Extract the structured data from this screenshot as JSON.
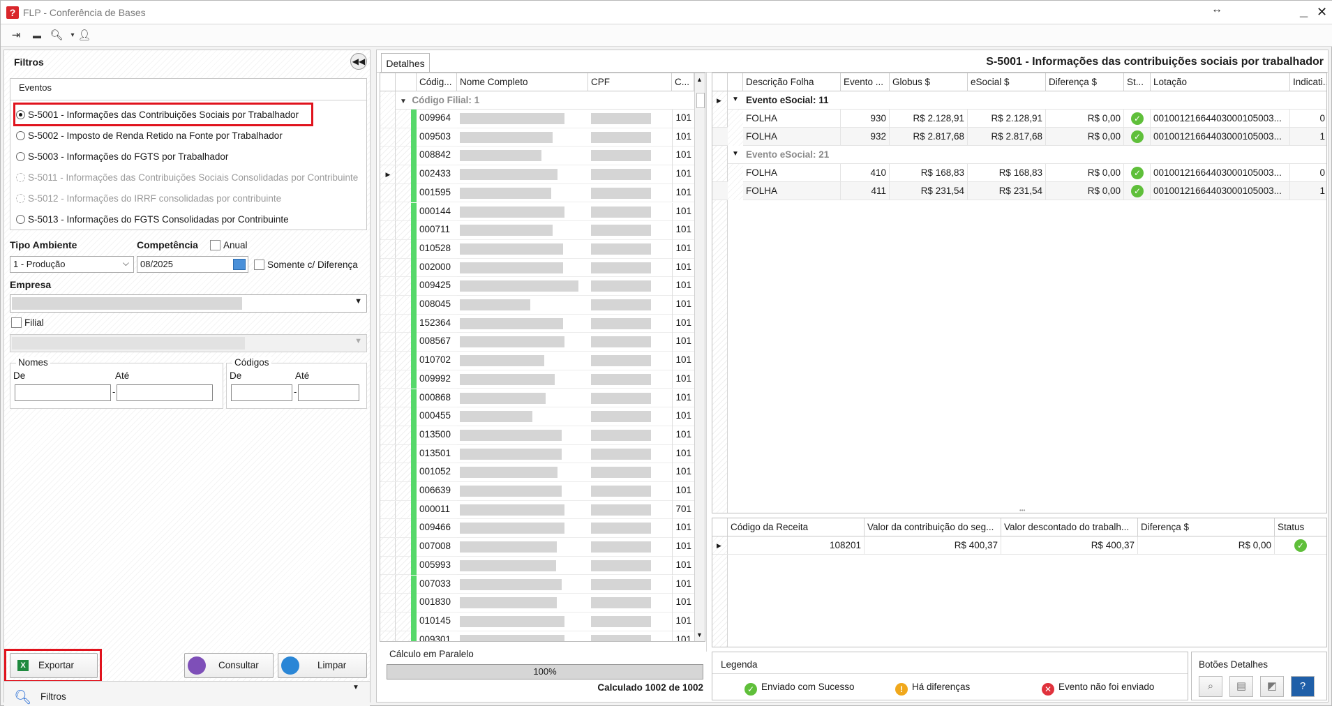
{
  "window": {
    "title": "FLP - Conferência de Bases",
    "logo_letter": "?"
  },
  "filters": {
    "title": "Filtros",
    "eventos_label": "Eventos",
    "events": [
      {
        "label": "S-5001 - Informações das Contribuições Sociais por Trabalhador",
        "selected": true,
        "enabled": true
      },
      {
        "label": "S-5002 - Imposto de Renda Retido na Fonte por Trabalhador",
        "selected": false,
        "enabled": true
      },
      {
        "label": "S-5003 - Informações do FGTS por Trabalhador",
        "selected": false,
        "enabled": true
      },
      {
        "label": "S-5011 - Informações das Contribuições Sociais Consolidadas por Contribuinte",
        "selected": false,
        "enabled": false
      },
      {
        "label": "S-5012 - Informações do IRRF consolidadas por contribuinte",
        "selected": false,
        "enabled": false
      },
      {
        "label": "S-5013 - Informações do FGTS Consolidadas por Contribuinte",
        "selected": false,
        "enabled": true
      }
    ],
    "tipo_ambiente_label": "Tipo Ambiente",
    "tipo_ambiente_value": "1 - Produção",
    "competencia_label": "Competência",
    "competencia_value": "08/2025",
    "anual_label": "Anual",
    "somente_diff_label": "Somente c/ Diferença",
    "empresa_label": "Empresa",
    "filial_label": "Filial",
    "nomes_label": "Nomes",
    "codigos_label": "Códigos",
    "de_label": "De",
    "ate_label": "Até",
    "export_label": "Exportar",
    "consultar_label": "Consultar",
    "limpar_label": "Limpar",
    "tab_label": "Filtros"
  },
  "details": {
    "tab_label": "Detalhes",
    "event_title": "S-5001 - Informações das contribuições sociais por trabalhador",
    "left_grid": {
      "headers": [
        "Códig...",
        "Nome Completo",
        "CPF",
        "C..."
      ],
      "group_label": "Código Filial: 1",
      "rows": [
        {
          "code": "009964",
          "c": "101"
        },
        {
          "code": "009503",
          "c": "101"
        },
        {
          "code": "008842",
          "c": "101"
        },
        {
          "code": "002433",
          "c": "101"
        },
        {
          "code": "001595",
          "c": "101"
        },
        {
          "code": "000144",
          "c": "101"
        },
        {
          "code": "000711",
          "c": "101"
        },
        {
          "code": "010528",
          "c": "101"
        },
        {
          "code": "002000",
          "c": "101"
        },
        {
          "code": "009425",
          "c": "101"
        },
        {
          "code": "008045",
          "c": "101"
        },
        {
          "code": "152364",
          "c": "101"
        },
        {
          "code": "008567",
          "c": "101"
        },
        {
          "code": "010702",
          "c": "101"
        },
        {
          "code": "009992",
          "c": "101"
        },
        {
          "code": "000868",
          "c": "101"
        },
        {
          "code": "000455",
          "c": "101"
        },
        {
          "code": "013500",
          "c": "101"
        },
        {
          "code": "013501",
          "c": "101"
        },
        {
          "code": "001052",
          "c": "101"
        },
        {
          "code": "006639",
          "c": "101"
        },
        {
          "code": "000011",
          "c": "701"
        },
        {
          "code": "009466",
          "c": "101"
        },
        {
          "code": "007008",
          "c": "101"
        },
        {
          "code": "005993",
          "c": "101"
        },
        {
          "code": "007033",
          "c": "101"
        },
        {
          "code": "001830",
          "c": "101"
        },
        {
          "code": "010145",
          "c": "101"
        },
        {
          "code": "009301",
          "c": "101"
        }
      ]
    },
    "calc_label": "Cálculo em Paralelo",
    "progress_text": "100%",
    "progress_value": 100,
    "calc_count": "Calculado 1002 de 1002",
    "right_grid": {
      "headers": [
        "Descrição Folha",
        "Evento ...",
        "Globus $",
        "eSocial $",
        "Diferença $",
        "St...",
        "Lotação",
        "Indicati..."
      ],
      "groups": [
        {
          "label": "Evento eSocial: 11",
          "expanded": true,
          "rows": [
            {
              "desc": "FOLHA",
              "evento": "930",
              "globus": "R$ 2.128,91",
              "esocial": "R$ 2.128,91",
              "dif": "R$ 0,00",
              "lotacao": "00100121664403000105003...",
              "ind": "0"
            },
            {
              "desc": "FOLHA",
              "evento": "932",
              "globus": "R$ 2.817,68",
              "esocial": "R$ 2.817,68",
              "dif": "R$ 0,00",
              "lotacao": "00100121664403000105003...",
              "ind": "1"
            }
          ]
        },
        {
          "label": "Evento eSocial: 21",
          "expanded": true,
          "rows": [
            {
              "desc": "FOLHA",
              "evento": "410",
              "globus": "R$ 168,83",
              "esocial": "R$ 168,83",
              "dif": "R$ 0,00",
              "lotacao": "00100121664403000105003...",
              "ind": "0"
            },
            {
              "desc": "FOLHA",
              "evento": "411",
              "globus": "R$ 231,54",
              "esocial": "R$ 231,54",
              "dif": "R$ 0,00",
              "lotacao": "00100121664403000105003...",
              "ind": "1"
            }
          ]
        }
      ]
    },
    "bottom_grid": {
      "headers": [
        "Código da Receita",
        "Valor da contribuição do seg...",
        "Valor descontado do trabalh...",
        "Diferença $",
        "Status"
      ],
      "rows": [
        {
          "codigo": "108201",
          "valor_contrib": "R$ 400,37",
          "valor_desc": "R$ 400,37",
          "dif": "R$ 0,00"
        }
      ]
    },
    "legend": {
      "title": "Legenda",
      "items": [
        {
          "label": "Enviado com Sucesso",
          "color": "#5fbf3a"
        },
        {
          "label": "Há diferenças",
          "color": "#f0a81c"
        },
        {
          "label": "Evento não foi enviado",
          "color": "#e0323c"
        }
      ]
    },
    "botoes_title": "Botões Detalhes"
  },
  "colors": {
    "highlight": "#e0131d",
    "status_green": "#56d86a",
    "accent_blue": "#2a6fd6"
  }
}
